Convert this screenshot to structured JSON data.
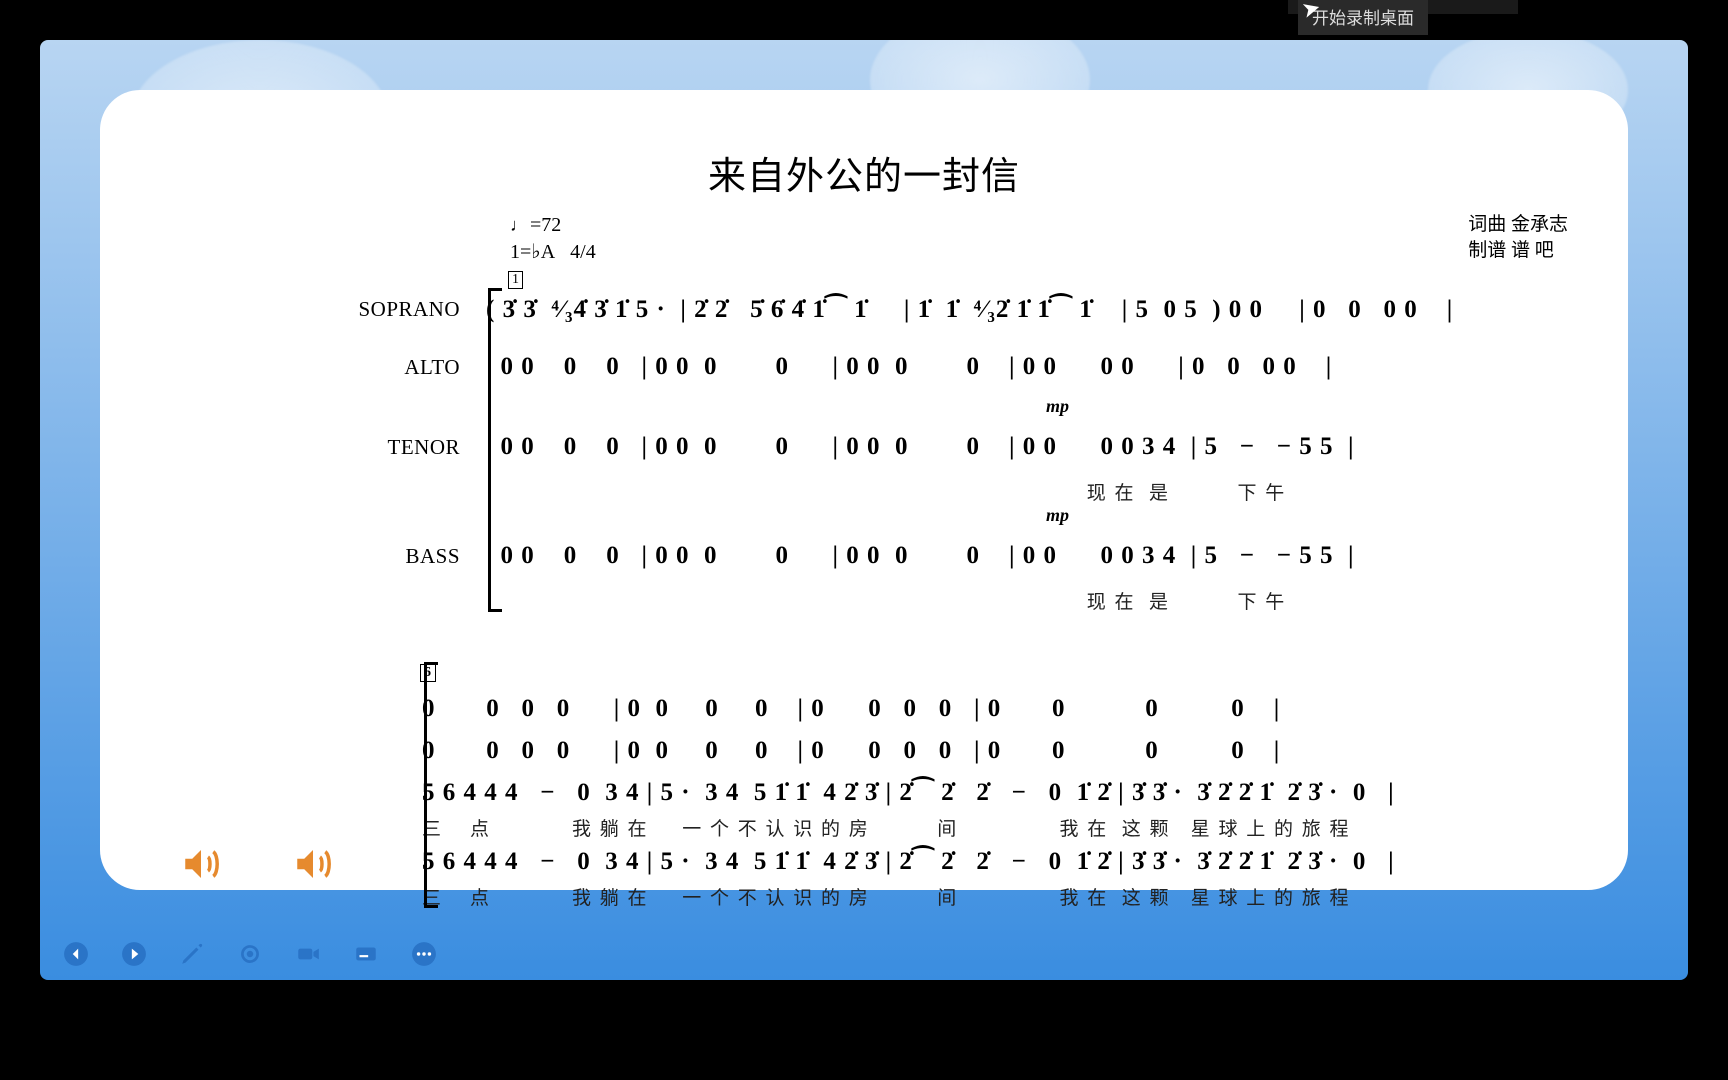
{
  "recording": {
    "tip": "开始录制桌面"
  },
  "sheet": {
    "title": "来自外公的一封信",
    "tempo": "=72",
    "key": "1=♭A",
    "timesig": "4/4",
    "bar1": "1",
    "bar6": "6",
    "credits": {
      "line1": "词曲 金承志",
      "line2": "制谱 谱 吧"
    },
    "voices": {
      "soprano": "SOPRANO",
      "alto": "ALTO",
      "tenor": "TENOR",
      "bass": "BASS"
    },
    "dynamic": "mp",
    "system1": {
      "soprano": "( 3̇ 3̇  ⁴⁄₃4̇ 3̇ 1̇ 5 ·  | 2̇ 2̇   5̇ 6̇ 4̇ 1̇⁀ 1̇     | 1̇  1̇  ⁴⁄₃2̇ 1̇ 1̇⁀ 1̇    | 5  0 5  ) 0 0     | 0   0   0 0    |",
      "alto": "  0 0    0    0   | 0 0  0        0      | 0 0  0        0    | 0 0      0 0      | 0   0   0 0    |",
      "tenor": "  0 0    0    0   | 0 0  0        0      | 0 0  0        0    | 0 0      0 0 3 4  | 5   −   − 5 5  |",
      "bass": "  0 0    0    0   | 0 0  0        0      | 0 0  0        0    | 0 0      0 0 3 4  | 5   −   − 5 5  |",
      "lyr_tenor": "                                                                                         现 在  是          下 午",
      "lyr_bass": "                                                                                         现 在  是          下 午"
    },
    "system2": {
      "r1": "0       0   0   0      | 0  0     0     0    | 0      0   0   0   | 0       0           0          0    |",
      "r2": "0       0   0   0      | 0  0     0     0    | 0      0   0   0   | 0       0           0          0    |",
      "r3": "5 6 4 4 4   −   0  3 4 | 5 ·  3 4  5 1̇ 1̇  4 2̇ 3̇ | 2̇⁀ 2̇   2̇   −   0  1̇ 2̇ | 3̇ 3̇ ·  3̇ 2̇ 2̇ 1̇  2̇ 3̇ ·  0   |",
      "r4": "5 6 4 4 4   −   0  3 4 | 5 ·  3 4  5 1̇ 1̇  4 2̇ 3̇ | 2̇⁀ 2̇   2̇   −   0  1̇ 2̇ | 3̇ 3̇ ·  3̇ 2̇ 2̇ 1̇  2̇ 3̇ ·  0   |",
      "lyr3": "三    点            我 躺 在     一 个 不 认 识 的 房          间               我 在  这 颗   星 球 上 的 旅 程",
      "lyr4": "三    点            我 躺 在     一 个 不 认 识 的 房          间               我 在  这 颗   星 球 上 的 旅 程"
    }
  },
  "toolbar": {
    "back": "back",
    "play": "play",
    "pen": "pen",
    "spotlight": "spotlight",
    "video": "video",
    "caption": "caption",
    "more": "more"
  }
}
